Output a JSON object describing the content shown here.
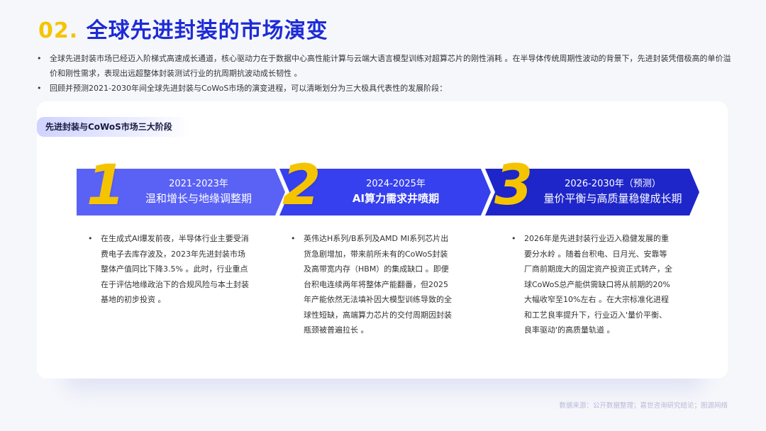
{
  "header": {
    "number": "02.",
    "title": "全球先进封装的市场演变"
  },
  "bullets": [
    "全球先进封装市场已经迈入阶梯式高速成长通道，核心驱动力在于数据中心高性能计算与云端大语言模型训练对超算芯片的刚性消耗 。在半导体传统周期性波动的背景下，先进封装凭借极高的单价溢价和刚性需求，表现出远超整体封装测试行业的抗周期抗波动成长韧性 。",
    "回顾并预测2021-2030年间全球先进封装与CoWoS市场的演变进程，可以清晰划分为三大极具代表性的发展阶段："
  ],
  "card": {
    "tag": "先进封装与CoWoS市场三大阶段",
    "stages": [
      {
        "number": "1",
        "years": "2021-2023年",
        "name": "温和增长与地缘调整期",
        "desc_lines": [
          "在生成式AI爆发前夜，半导体行业主要受消",
          "费电子去库存波及，2023年先进封装市场",
          "整体产值同比下降3.5% 。此时，行业重点",
          "在于评估地缘政治下的合规风险与本土封装",
          "基地的初步投资 。"
        ]
      },
      {
        "number": "2",
        "years": "2024-2025年",
        "name": "AI算力需求井喷期",
        "desc_lines": [
          "英伟达H系列/B系列及AMD MI系列芯片出",
          "货急剧增加，带来前所未有的CoWoS封装",
          "及高带宽内存（HBM）的集成缺口 。即便",
          "台积电连续两年将整体产能翻番，但2025",
          "年产能依然无法填补因大模型训练导致的全",
          "球性短缺，高端算力芯片的交付周期因封装",
          "瓶颈被普遍拉长 。"
        ]
      },
      {
        "number": "3",
        "years": "2026-2030年（预测）",
        "name": "量价平衡与高质量稳健成长期",
        "desc_lines": [
          "2026年是先进封装行业迈入稳健发展的重",
          "要分水岭 。随着台积电、日月光、安靠等",
          "厂商前期庞大的固定资产投资正式转产，全",
          "球CoWoS总产能供需缺口将从前期的20%",
          "大幅收窄至10%左右 。在大宗标准化进程",
          "和工艺良率提升下，行业迈入'量价平衡、",
          "良率驱动'的高质量轨道 。"
        ]
      }
    ]
  },
  "footer": {
    "source": "数据来源：公开数据整理；嘉世咨询研究结论；图源网络"
  },
  "colors": {
    "accent_yellow": "#f5c400",
    "title_blue": "#1d2bd6",
    "arrow1": "#5a62f5",
    "arrow2": "#3640ee",
    "arrow3": "#1e26c9"
  }
}
